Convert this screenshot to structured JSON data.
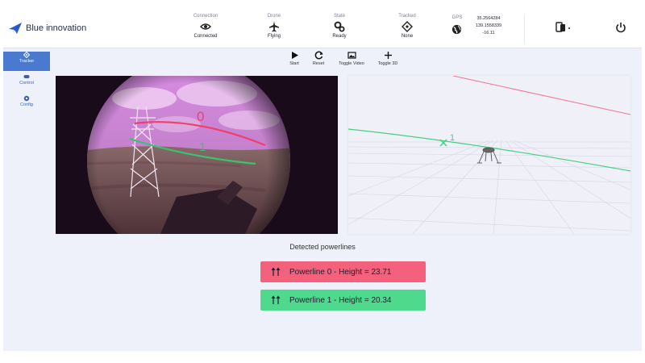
{
  "app": {
    "brand": "Blue innovation"
  },
  "header": {
    "connection": {
      "label": "Connection",
      "value": "Connected",
      "icon": "eye-icon"
    },
    "drone": {
      "label": "Drone",
      "value": "Flying",
      "icon": "airplane-icon"
    },
    "state": {
      "label": "State",
      "value": "Ready",
      "icon": "gears-icon"
    },
    "tracked": {
      "label": "Tracked",
      "value": "None",
      "icon": "crosshair-icon"
    },
    "gps": {
      "label": "GPS",
      "lat": "35.2564284",
      "lon": "139.1558339",
      "alt": "-16.11",
      "icon": "globe-icon"
    },
    "device_menu_icon": "phone-switch-icon",
    "power_icon": "power-icon"
  },
  "sidebar": {
    "items": [
      {
        "label": "Tracker",
        "icon": "crosshair-icon",
        "active": true
      },
      {
        "label": "Control",
        "icon": "gamepad-icon",
        "active": false
      },
      {
        "label": "Config",
        "icon": "gear-icon",
        "active": false
      }
    ]
  },
  "toolbar": {
    "start_label": "Start",
    "reset_label": "Reset",
    "toggle_video_label": "Toggle Video",
    "toggle_3d_label": "Toggle 3D"
  },
  "camera": {
    "line_labels": [
      "0",
      "1"
    ]
  },
  "scene3d": {
    "marker_label": "1"
  },
  "results": {
    "title": "Detected powerlines",
    "items": [
      {
        "text": "Powerline 0 - Height = 23.71",
        "color": "#f4617d"
      },
      {
        "text": "Powerline 1 - Height = 20.34",
        "color": "#4fd98c"
      }
    ]
  },
  "colors": {
    "accent": "#4a7ad0",
    "powerline_0": "#f4617d",
    "powerline_1": "#4fd98c",
    "background": "#eef0fa"
  }
}
